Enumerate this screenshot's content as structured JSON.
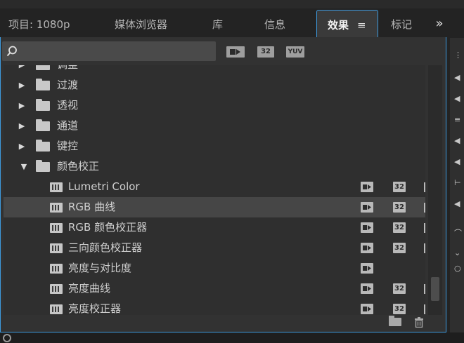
{
  "tabs": [
    {
      "label": "项目: 1080p",
      "active": false
    },
    {
      "label": "媒体浏览器",
      "active": false
    },
    {
      "label": "库",
      "active": false
    },
    {
      "label": "信息",
      "active": false
    },
    {
      "label": "效果",
      "active": true
    },
    {
      "label": "标记",
      "active": false
    }
  ],
  "tab_menu_glyph": "≡",
  "overflow_glyph": "»",
  "search": {
    "value": "",
    "placeholder": ""
  },
  "filter_buttons": [
    "accelerated-effects",
    "32",
    "YUV"
  ],
  "tree": [
    {
      "type": "folder",
      "label": "调整",
      "expanded": false,
      "indent": 0
    },
    {
      "type": "folder",
      "label": "过渡",
      "expanded": false,
      "indent": 0
    },
    {
      "type": "folder",
      "label": "透视",
      "expanded": false,
      "indent": 0
    },
    {
      "type": "folder",
      "label": "通道",
      "expanded": false,
      "indent": 0
    },
    {
      "type": "folder",
      "label": "键控",
      "expanded": false,
      "indent": 0
    },
    {
      "type": "folder",
      "label": "颜色校正",
      "expanded": true,
      "indent": 0
    },
    {
      "type": "effect",
      "label": "Lumetri Color",
      "accel": true,
      "bit32": true,
      "yuv": true
    },
    {
      "type": "effect",
      "label": "RGB 曲线",
      "accel": true,
      "bit32": true,
      "yuv": true,
      "selected": true
    },
    {
      "type": "effect",
      "label": "RGB 颜色校正器",
      "accel": true,
      "bit32": true,
      "yuv": true
    },
    {
      "type": "effect",
      "label": "三向颜色校正器",
      "accel": true,
      "bit32": true,
      "yuv": true
    },
    {
      "type": "effect",
      "label": "亮度与对比度",
      "accel": true,
      "bit32": false,
      "yuv": false
    },
    {
      "type": "effect",
      "label": "亮度曲线",
      "accel": true,
      "bit32": true,
      "yuv": true
    },
    {
      "type": "effect",
      "label": "亮度校正器",
      "accel": true,
      "bit32": true,
      "yuv": true
    }
  ],
  "badge_32_text": "32",
  "badge_yuv_text": "YUV",
  "colors": {
    "accent": "#3d9be0",
    "panel_bg": "#323232",
    "selected_row": "#464646"
  }
}
